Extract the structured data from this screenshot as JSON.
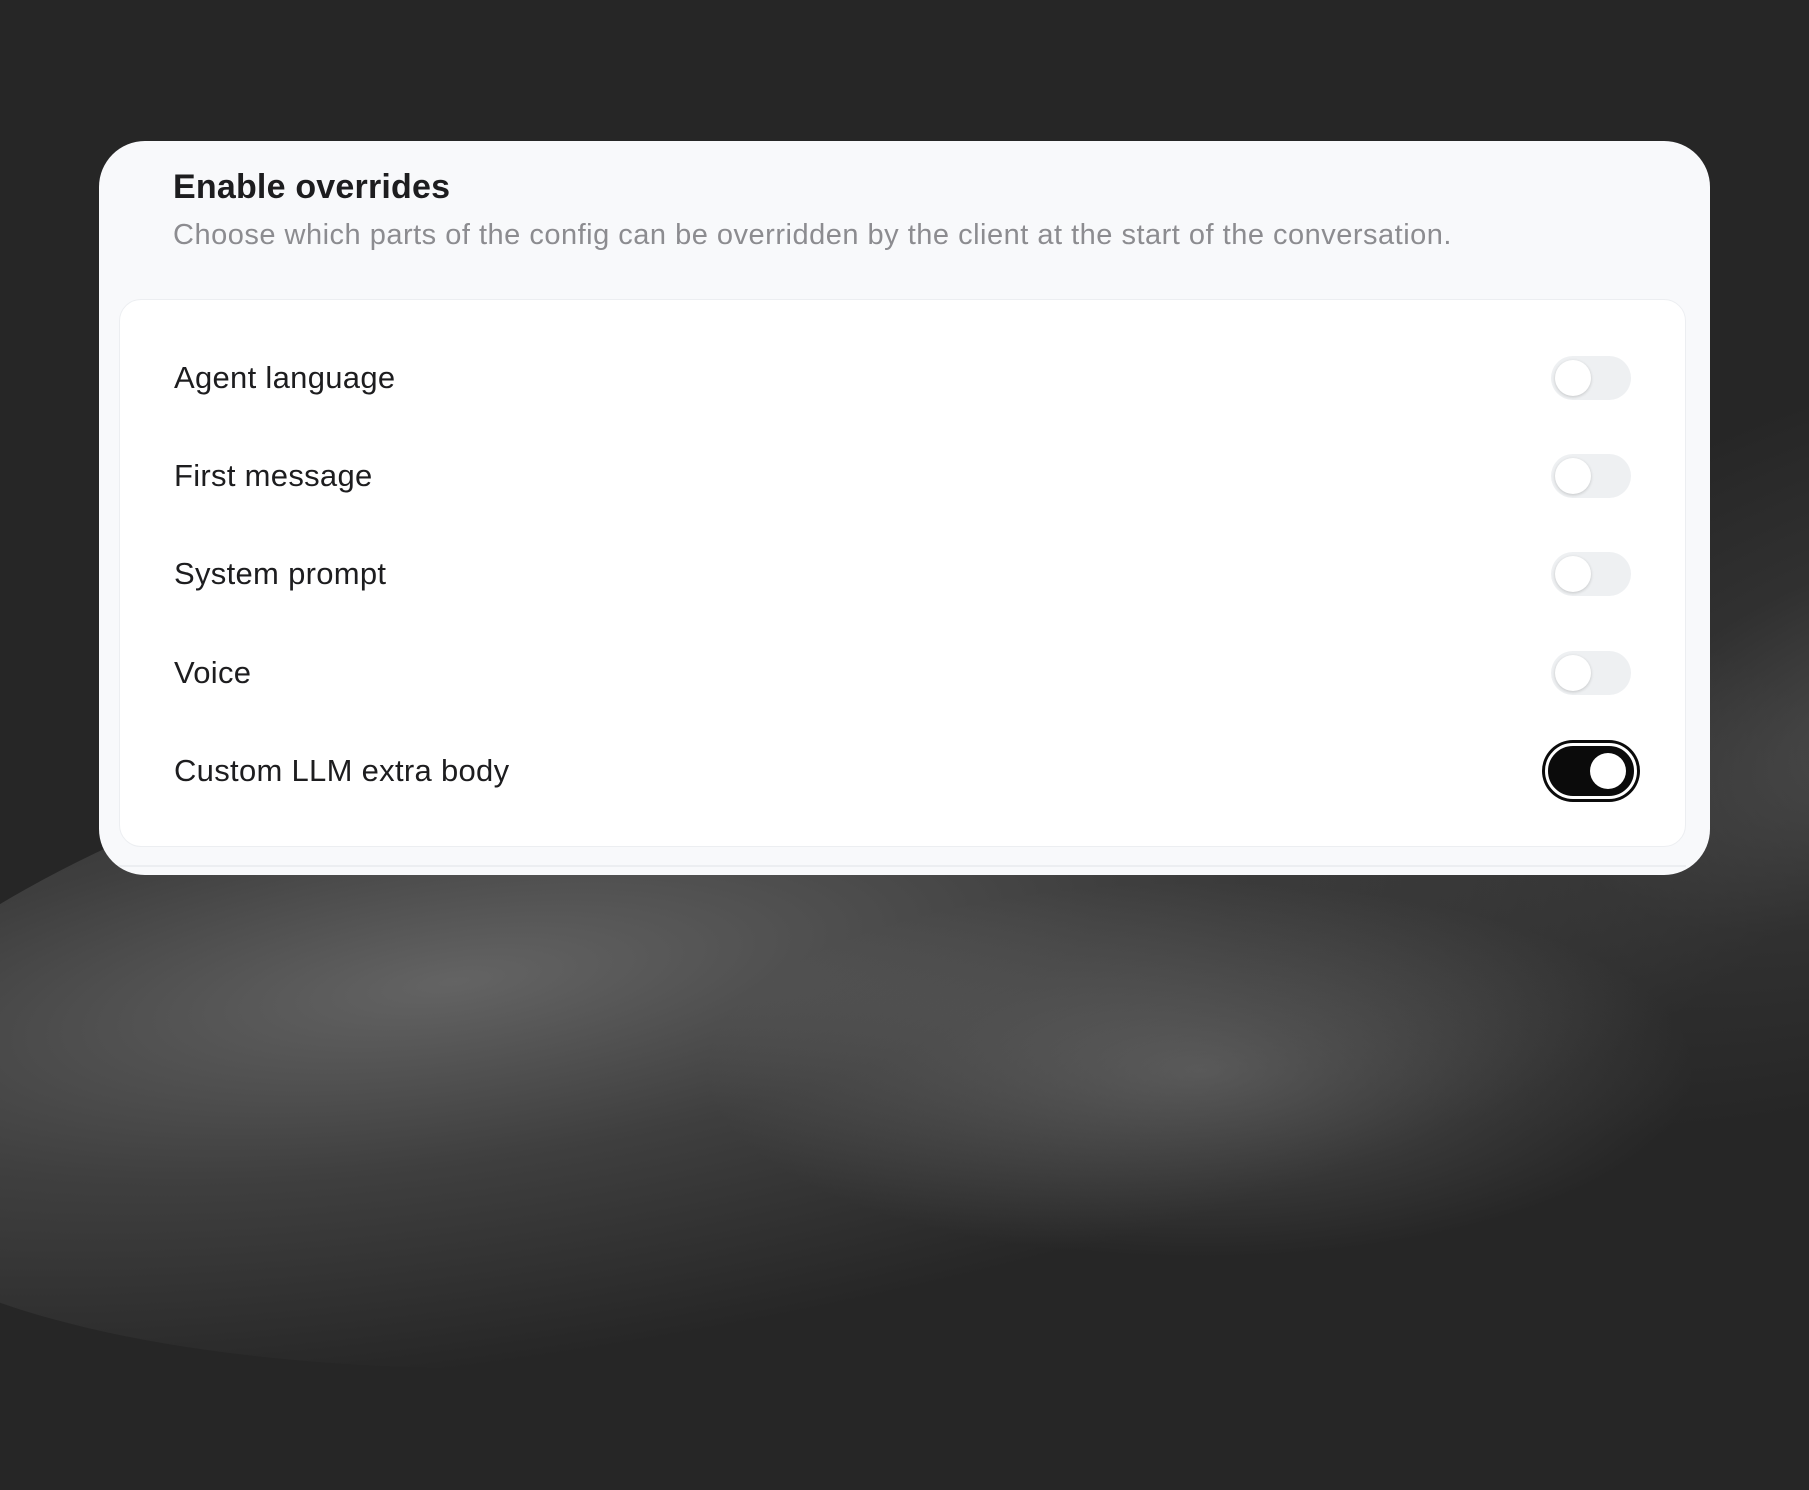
{
  "card": {
    "title": "Enable overrides",
    "subtitle": "Choose which parts of the config can be overridden by the client at the start of the conversation."
  },
  "overrides": [
    {
      "label": "Agent language",
      "enabled": false
    },
    {
      "label": "First message",
      "enabled": false
    },
    {
      "label": "System prompt",
      "enabled": false
    },
    {
      "label": "Voice",
      "enabled": false
    },
    {
      "label": "Custom LLM extra body",
      "enabled": true
    }
  ],
  "colors": {
    "backdrop": "#262626",
    "card": "#f8f9fb",
    "toggle_off": "#eef0f2",
    "toggle_on": "#0b0b0b"
  }
}
